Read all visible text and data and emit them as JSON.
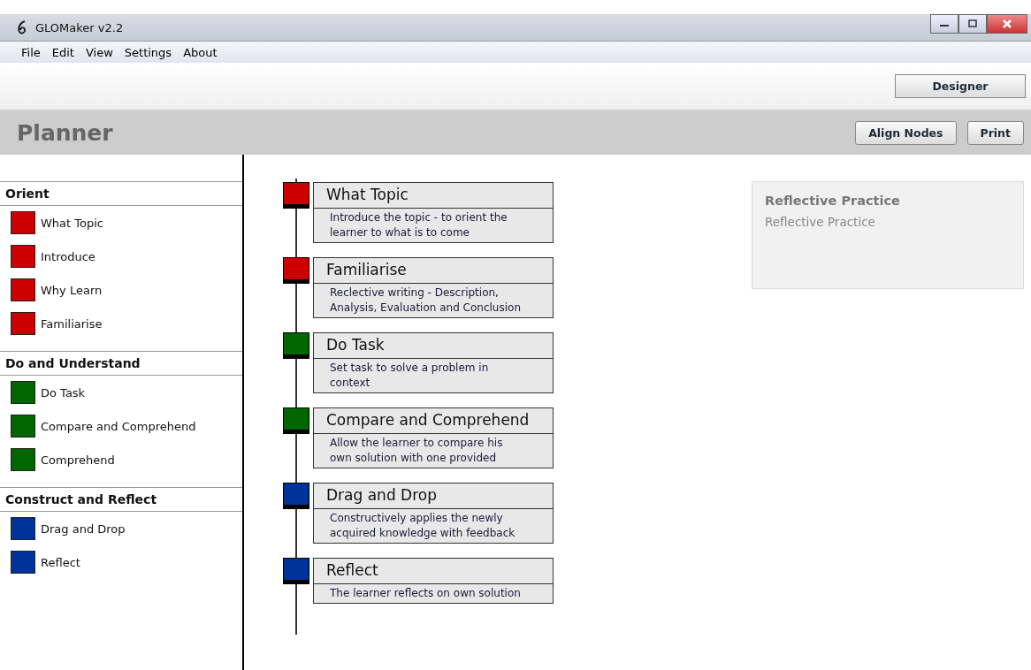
{
  "window": {
    "title": "GLOMaker v2.2"
  },
  "menu": [
    "File",
    "Edit",
    "View",
    "Settings",
    "About"
  ],
  "toolbar": {
    "button": "Designer"
  },
  "header": {
    "title": "Planner",
    "buttons": [
      "Align Nodes",
      "Print"
    ]
  },
  "sidebar": {
    "sections": [
      {
        "title": "Orient",
        "items": [
          {
            "label": "What Topic",
            "color": "#cc0000"
          },
          {
            "label": "Introduce",
            "color": "#cc0000"
          },
          {
            "label": "Why Learn",
            "color": "#cc0000"
          },
          {
            "label": "Familiarise",
            "color": "#cc0000"
          }
        ]
      },
      {
        "title": "Do and Understand",
        "items": [
          {
            "label": "Do Task",
            "color": "#006600"
          },
          {
            "label": "Compare and Comprehend",
            "color": "#006600"
          },
          {
            "label": "Comprehend",
            "color": "#006600"
          }
        ]
      },
      {
        "title": "Construct and Reflect",
        "items": [
          {
            "label": "Drag and Drop",
            "color": "#003399"
          },
          {
            "label": "Reflect",
            "color": "#003399"
          }
        ]
      }
    ]
  },
  "nodes": [
    {
      "title": "What Topic",
      "description": "Introduce the topic - to orient the learner to what is to come",
      "color": "#cc0000"
    },
    {
      "title": "Familiarise",
      "description": "Reclective writing - Description, Analysis, Evaluation and Conclusion",
      "color": "#cc0000"
    },
    {
      "title": "Do Task",
      "description": "Set task to solve a problem in context",
      "color": "#006600"
    },
    {
      "title": "Compare and Comprehend",
      "description": "Allow the learner to compare his own solution with one provided",
      "color": "#006600"
    },
    {
      "title": "Drag and Drop",
      "description": "Constructively applies the newly acquired knowledge with feedback",
      "color": "#003399"
    },
    {
      "title": "Reflect",
      "description": "The learner reflects on own solution",
      "color": "#003399"
    }
  ],
  "info_panel": {
    "title": "Reflective Practice",
    "text": "Reflective Practice"
  }
}
